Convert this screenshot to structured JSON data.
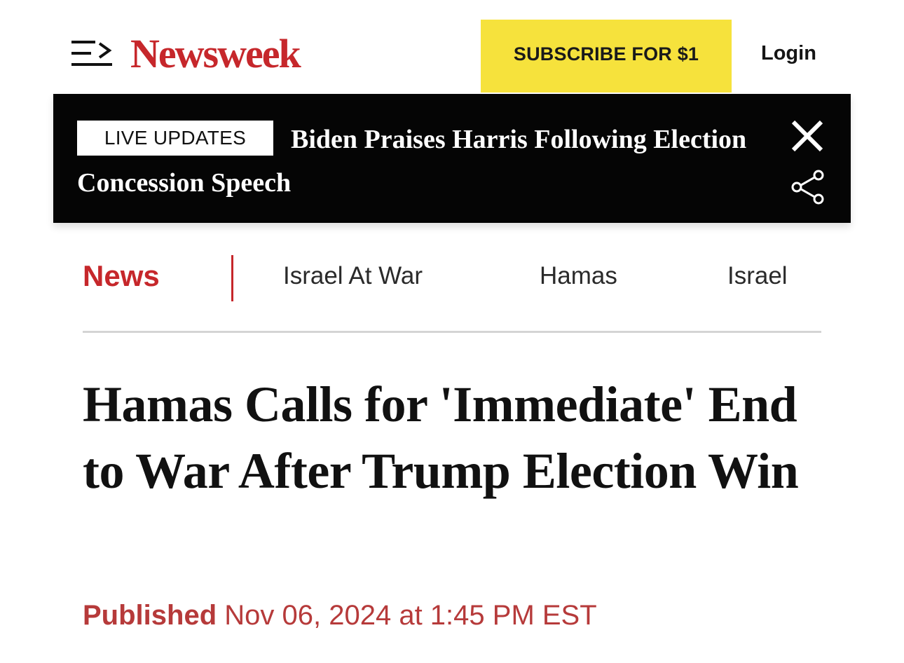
{
  "header": {
    "logo_text": "Newsweek",
    "subscribe_label": "SUBSCRIBE FOR $1",
    "login_label": "Login"
  },
  "live_banner": {
    "badge": "LIVE UPDATES",
    "headline": "Biden Praises Harris Following Election Concession Speech"
  },
  "subnav": {
    "section": "News",
    "links": [
      "Israel At War",
      "Hamas",
      "Israel"
    ]
  },
  "article": {
    "headline": "Hamas Calls for 'Immediate' End to War After Trump Election Win",
    "published_label": "Published",
    "published_date": "Nov 06, 2024 at 1:45 PM EST"
  },
  "icons": {
    "menu": "menu-icon",
    "close": "close-icon",
    "share": "share-icon"
  },
  "colors": {
    "brand_red": "#c6272b",
    "subscribe_yellow": "#f6e23c",
    "banner_black": "#050505",
    "published_red": "#b63a3a"
  }
}
